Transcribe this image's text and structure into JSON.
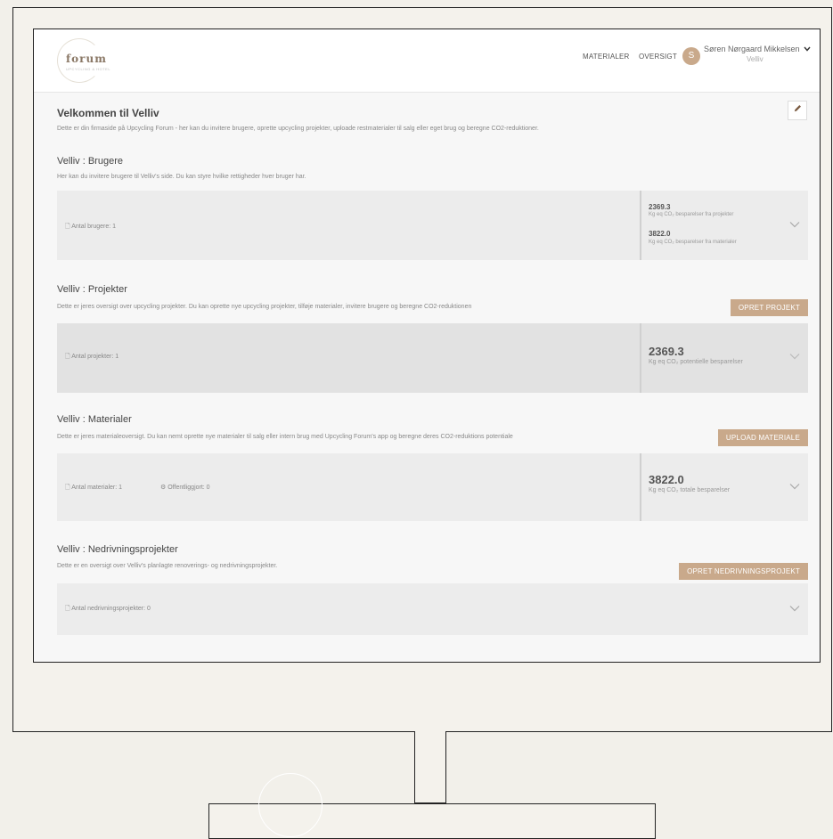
{
  "header": {
    "logo_word": "forum",
    "logo_sub": "UPCYCLING & HOTEL",
    "nav": [
      "MATERIALER",
      "OVERSIGT"
    ],
    "avatar_initial": "S",
    "user_name": "Søren Nørgaard Mikkelsen",
    "user_org": "Velliv"
  },
  "intro": {
    "title": "Velkommen til Velliv",
    "desc": "Dette er din firmaside på Upcycling Forum - her kan du invitere brugere, oprette upcycling projekter, uploade restmaterialer til salg eller eget brug og beregne CO2-reduktioner."
  },
  "users": {
    "title": "Velliv : Brugere",
    "desc": "Her kan du invitere brugere til Velliv's side. Du kan styre hvilke rettigheder hver bruger har.",
    "count_label": "Antal brugere: 1",
    "stat1_value": "2369.3",
    "stat1_sub": "Kg eq CO₂ besparelser fra projekter",
    "stat2_value": "3822.0",
    "stat2_sub": "Kg eq CO₂ besparelser fra materialer"
  },
  "projects": {
    "title": "Velliv : Projekter",
    "desc": "Dette er jeres oversigt over upcycling projekter. Du kan oprette nye upcycling projekter, tilføje materialer, invitere brugere og beregne CO2-reduktionen",
    "button": "OPRET PROJEKT",
    "count_label": "Antal projekter: 1",
    "stat_value": "2369.3",
    "stat_sub": "Kg eq CO₂ potentielle besparelser"
  },
  "materials": {
    "title": "Velliv : Materialer",
    "desc": "Dette er jeres materialeoversigt. Du kan nemt oprette nye materialer til salg eller intern brug med Upcycling Forum's app og beregne deres CO2-reduktions potentiale",
    "button": "UPLOAD MATERIALE",
    "count_label": "Antal materialer: 1",
    "public_label": "Offentliggjort: 0",
    "stat_value": "3822.0",
    "stat_sub": "Kg eq CO₂ totale besparelser"
  },
  "demolition": {
    "title": "Velliv : Nedrivningsprojekter",
    "desc": "Dette er en oversigt over Velliv's planlagte renoverings- og nedrivningsprojekter.",
    "button": "OPRET NEDRIVNINGSPROJEKT",
    "count_label": "Antal nedrivningsprojekter: 0"
  },
  "colors": {
    "accent": "#c9a98b",
    "card": "#ececec"
  }
}
